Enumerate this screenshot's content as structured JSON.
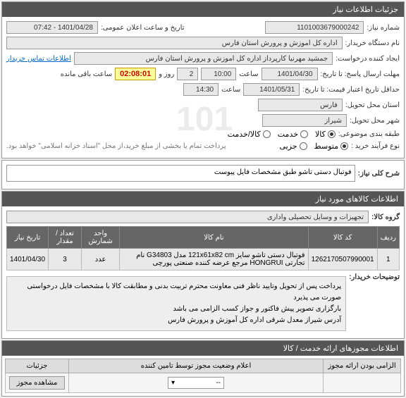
{
  "panel1": {
    "title": "جزئیات اطلاعات نیاز",
    "need_no_label": "شماره نیاز:",
    "need_no": "1101003679000242",
    "announce_label": "تاریخ و ساعت اعلان عمومی:",
    "announce_value": "1401/04/28 - 07:42",
    "buyer_label": "نام دستگاه خریدار:",
    "buyer_value": "اداره کل اموزش و پرورش استان فارس",
    "creator_label": "ایجاد کننده درخواست:",
    "creator_value": "جمشید مهرنیا کارپرداز اداره کل اموزش و پرورش استان فارس",
    "contact_link": "اطلاعات تماس خریدار",
    "deadline_label": "مهلت ارسال پاسخ: تا تاریخ:",
    "deadline_date": "1401/04/30",
    "time_label": "ساعت",
    "deadline_time": "10:00",
    "day_label": "روز و",
    "day_value": "2",
    "remaining": "02:08:01",
    "remaining_label": "ساعت باقی مانده",
    "validity_label": "حداقل تاریخ اعتبار قیمت: تا تاریخ:",
    "validity_date": "1401/05/31",
    "validity_time": "14:30",
    "province_label": "استان محل تحویل:",
    "province_value": "فارس",
    "city_label": "شهر محل تحویل:",
    "city_value": "شیراز",
    "category_label": "طبقه بندی موضوعی:",
    "cat_kala": "کالا",
    "cat_khadamat": "خدمت",
    "cat_both": "کالا/خدمت",
    "process_label": "نوع فرآیند خرید :",
    "proc_mid": "متوسط",
    "proc_small": "جزیی",
    "payment_note": "پرداخت تمام یا بخشی از مبلغ خرید،از محل \"اسناد خزانه اسلامی\" خواهد بود."
  },
  "panel2": {
    "desc_label": "شرح کلی نیاز:",
    "desc_value": "فوتبال دستی تاشو طبق مشخصات فایل پیوست"
  },
  "panel3": {
    "title": "اطلاعات کالاهای مورد نیاز",
    "group_label": "گروه کالا:",
    "group_value": "تجهیزات و وسایل تحصیلی واداری",
    "headers": {
      "row": "ردیف",
      "code": "کد کالا",
      "name": "نام کالا",
      "unit": "واحد شمارش",
      "qty": "تعداد / مقدار",
      "date": "تاریخ نیاز"
    },
    "items": [
      {
        "row": "1",
        "code": "1262170507990001",
        "name": "فوتبال دستی تاشو سایز 121x61x82 cm مدل G34803 نام تجارتی HONGRUI مرجع عرضه كننده صنعتی پورچی",
        "unit": "عدد",
        "qty": "3",
        "date": "1401/04/30"
      }
    ],
    "buyer_notes_label": "توضیحات خریدار:",
    "buyer_notes": "پرداخت پس از تحویل وتایید ناظر فنی معاونت محترم تربیت بدنی و مطابقت کالا با مشخصات فایل درخواستی صورت می پذیرد\nبارگزاری تصویر پیش فاکتور و جواز کسب الزامی می باشد\nآدرس شیراز معدل شرقی اداره کل آموزش و پرورش فارس"
  },
  "panel4": {
    "title": "اطلاعات مجوزهای ارائه خدمت / کالا",
    "mandatory_label": "الزامی بودن ارائه مجوز",
    "status_label": "اعلام وضعیت مجوز توسط تامین کننده",
    "details_label": "جزئیات",
    "view_btn": "مشاهده مجوز",
    "select_placeholder": "--"
  }
}
